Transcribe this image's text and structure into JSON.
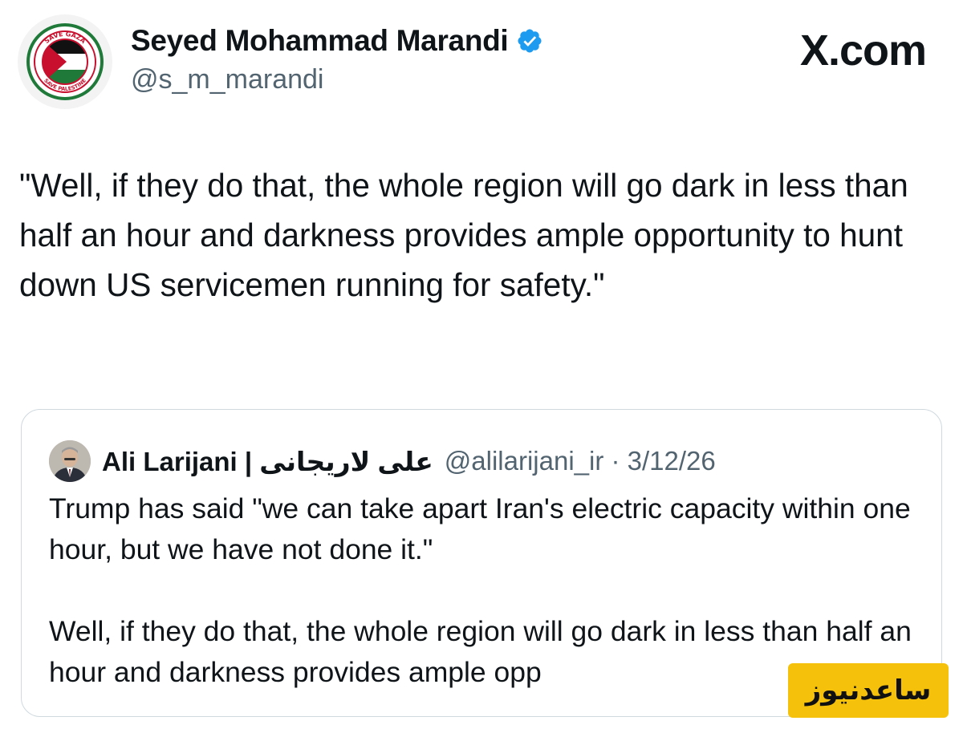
{
  "tweet": {
    "author": {
      "display_name": "Seyed Mohammad Marandi",
      "handle": "@s_m_marandi",
      "verified_icon": "verified-badge-icon",
      "avatar_ring_text_top": "SAVE GAZA",
      "avatar_ring_text_bottom": "SAVE PALESTINE"
    },
    "brand": "X.com",
    "text": "\"Well, if they do that, the whole region will go dark in less than half an hour and darkness provides ample opportunity to hunt down US servicemen running for safety.\""
  },
  "quoted_tweet": {
    "author_name": "Ali Larijani | علی لاریجانی",
    "handle_date": "@alilarijani_ir · 3/12/26",
    "paragraph_1": "Trump has said \"we can take apart Iran's electric capacity within one hour, but we have not done it.\"",
    "paragraph_2": "Well, if they do that, the whole region will go dark in less than half an hour and darkness provides ample opp"
  },
  "watermark": {
    "text": "ساعدنیوز"
  },
  "colors": {
    "text": "#0f1419",
    "secondary": "#536471",
    "verified": "#1d9bf0",
    "border": "#cfd9de",
    "watermark_bg": "#f5c10a"
  }
}
